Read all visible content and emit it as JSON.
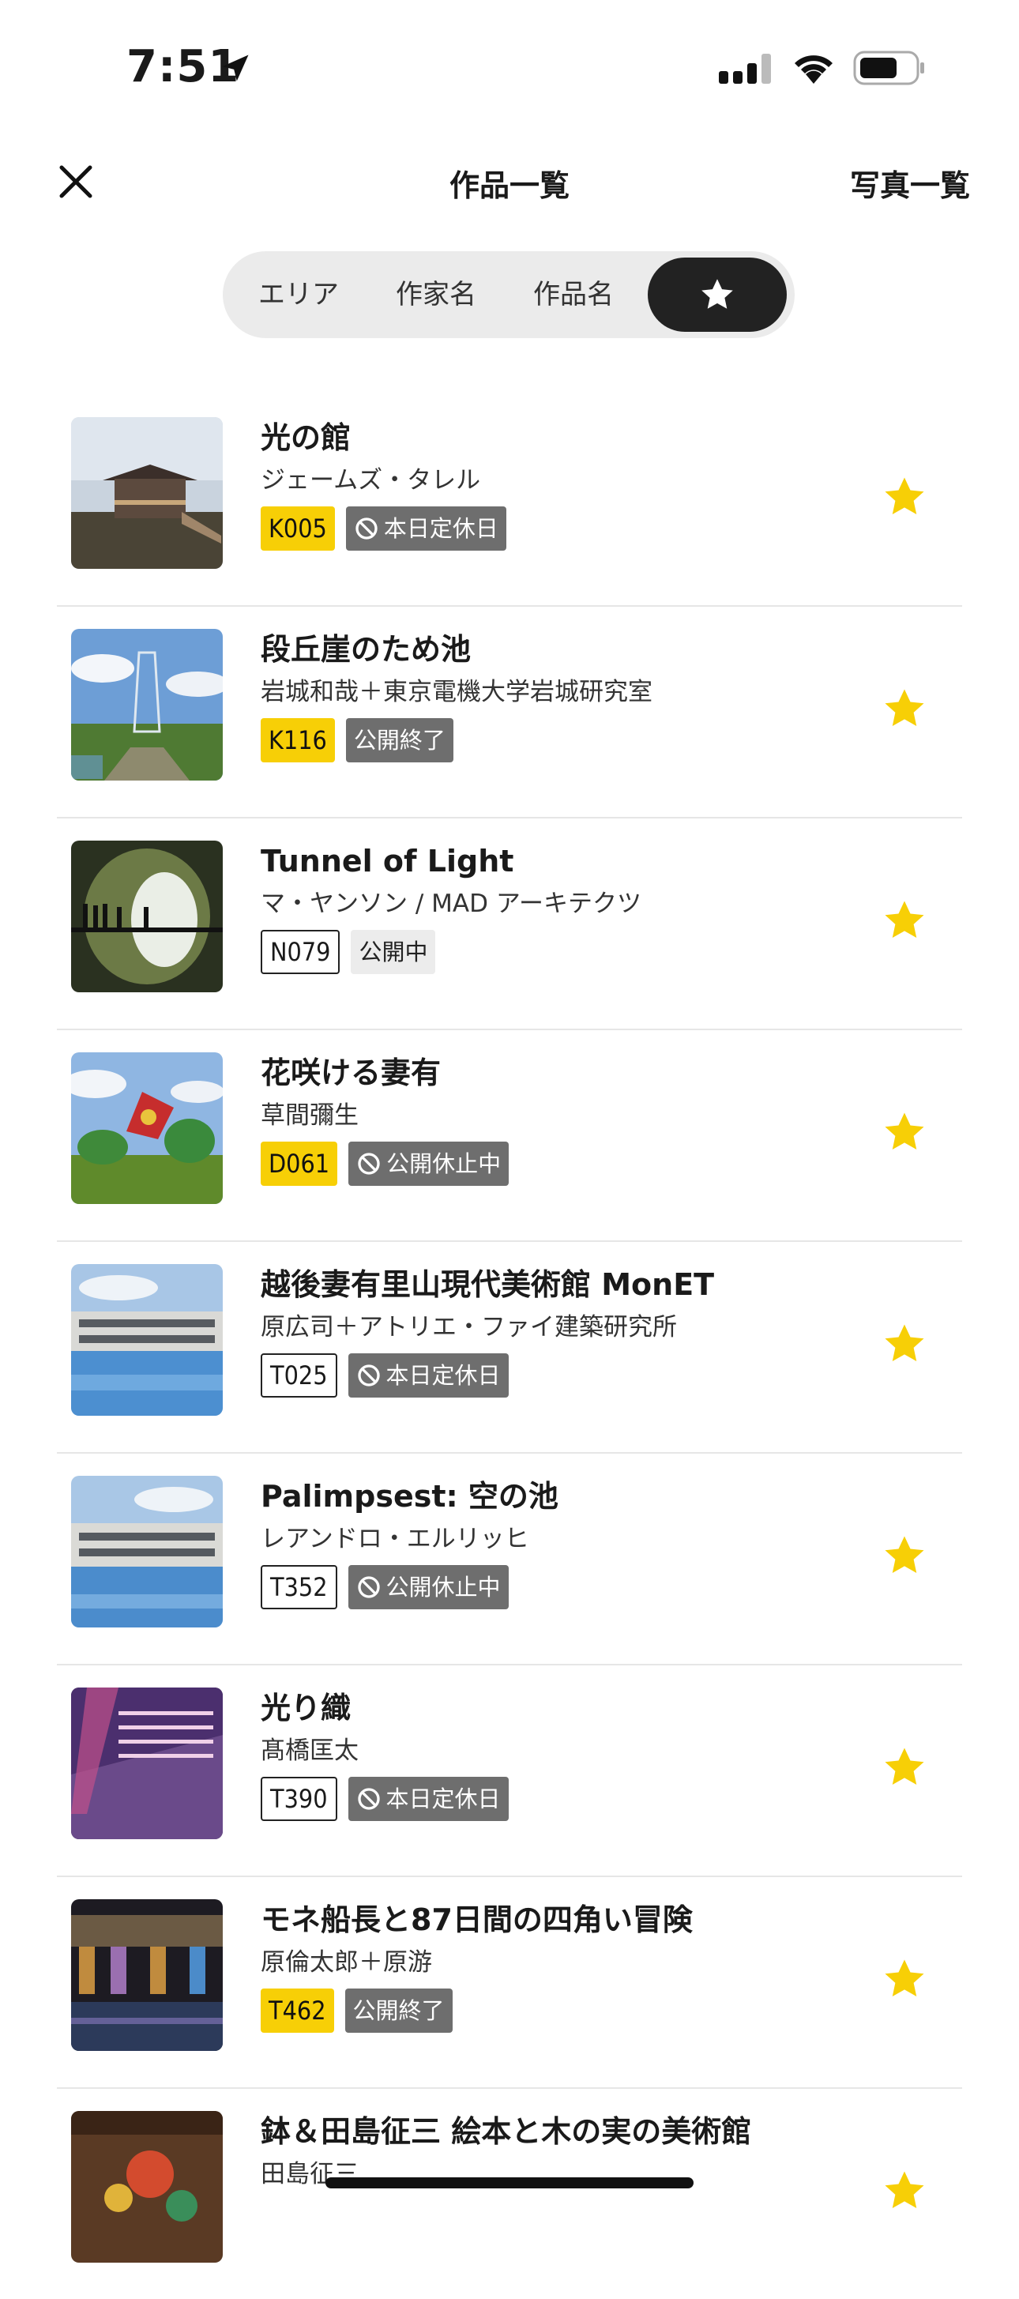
{
  "status_bar": {
    "time": "7:51"
  },
  "header": {
    "title": "作品一覧",
    "photo_list": "写真一覧"
  },
  "tabs": [
    {
      "label": "エリア"
    },
    {
      "label": "作家名"
    },
    {
      "label": "作品名"
    },
    {
      "label": "",
      "icon": "star-icon",
      "selected": true
    }
  ],
  "accent": "#f7cf06",
  "works": [
    {
      "title": "光の館",
      "artist": "ジェームズ・タレル",
      "code": "K005",
      "code_style": "yellow",
      "status": "本日定休日",
      "status_icon": true
    },
    {
      "title": "段丘崖のため池",
      "artist": "岩城和哉＋東京電機大学岩城研究室",
      "code": "K116",
      "code_style": "yellow",
      "status": "公開終了",
      "status_icon": false
    },
    {
      "title": "Tunnel of Light",
      "artist": "マ・ヤンソン / MAD アーキテクツ",
      "code": "N079",
      "code_style": "outline",
      "status": "公開中",
      "status_icon": false
    },
    {
      "title": "花咲ける妻有",
      "artist": "草間彌生",
      "code": "D061",
      "code_style": "yellow",
      "status": "公開休止中",
      "status_icon": true
    },
    {
      "title": "越後妻有里山現代美術館 MonET",
      "artist": "原広司＋アトリエ・ファイ建築研究所",
      "code": "T025",
      "code_style": "outline",
      "status": "本日定休日",
      "status_icon": true
    },
    {
      "title": "Palimpsest: 空の池",
      "artist": "レアンドロ・エルリッヒ",
      "code": "T352",
      "code_style": "outline",
      "status": "公開休止中",
      "status_icon": true
    },
    {
      "title": "光り織",
      "artist": "髙橋匡太",
      "code": "T390",
      "code_style": "outline",
      "status": "本日定休日",
      "status_icon": true
    },
    {
      "title": "モネ船長と87日間の四角い冒険",
      "artist": "原倫太郎＋原游",
      "code": "T462",
      "code_style": "yellow",
      "status": "公開終了",
      "status_icon": false
    },
    {
      "title": "鉢＆田島征三 絵本と木の実の美術館",
      "artist": "田島征三",
      "code": "",
      "code_style": "outline",
      "status": "",
      "status_icon": false
    }
  ]
}
